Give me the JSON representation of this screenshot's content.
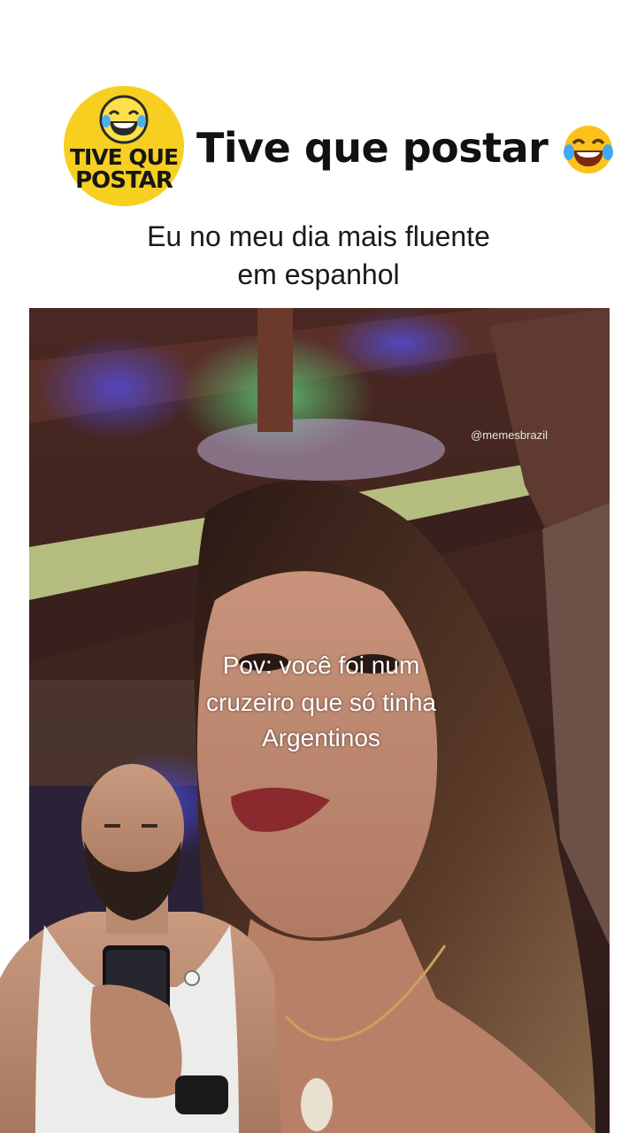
{
  "header": {
    "logo": {
      "line1": "TIVE QUE",
      "line2": "POSTAR",
      "icon": "laughing-tears-emoji",
      "color": "#f6cf21"
    },
    "title": "Tive que postar",
    "title_icon": "laughing-tears-emoji"
  },
  "caption": {
    "line1": "Eu no meu dia mais fluente",
    "line2": "em espanhol"
  },
  "video": {
    "watermark": "@memesbrazil",
    "overlay_line1": "Pov:  você foi num",
    "overlay_line2": "cruzeiro que só tinha",
    "overlay_line3": "Argentinos"
  }
}
